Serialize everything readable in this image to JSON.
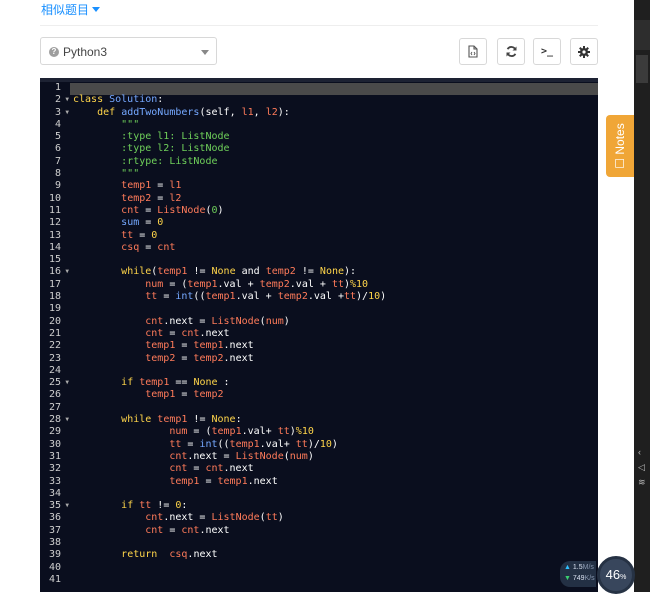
{
  "header": {
    "similar_label": "相似题目"
  },
  "toolbar": {
    "language": "Python3",
    "console_glyph": ">_"
  },
  "notes": {
    "label": "Notes"
  },
  "editor": {
    "line_numbers": [
      "1",
      "2",
      "3",
      "4",
      "5",
      "6",
      "7",
      "8",
      "9",
      "10",
      "11",
      "12",
      "13",
      "14",
      "15",
      "16",
      "17",
      "18",
      "19",
      "20",
      "21",
      "22",
      "23",
      "24",
      "25",
      "26",
      "27",
      "28",
      "29",
      "30",
      "31",
      "32",
      "33",
      "34",
      "35",
      "36",
      "37",
      "38",
      "39",
      "40",
      "41"
    ],
    "fold_lines": [
      2,
      3,
      16,
      25,
      28,
      35
    ],
    "lines": [
      [],
      [
        [
          "k",
          "class "
        ],
        [
          "f",
          "Solution"
        ],
        [
          "n",
          ":"
        ]
      ],
      [
        [
          "n",
          "    "
        ],
        [
          "k",
          "def "
        ],
        [
          "f",
          "addTwoNumbers"
        ],
        [
          "n",
          "(self, "
        ],
        [
          "p",
          "l1"
        ],
        [
          "n",
          ", "
        ],
        [
          "p",
          "l2"
        ],
        [
          "n",
          "):"
        ]
      ],
      [
        [
          "c",
          "        \"\"\""
        ]
      ],
      [
        [
          "c",
          "        :type l1: ListNode"
        ]
      ],
      [
        [
          "c",
          "        :type l2: ListNode"
        ]
      ],
      [
        [
          "c",
          "        :rtype: ListNode"
        ]
      ],
      [
        [
          "c",
          "        \"\"\""
        ]
      ],
      [
        [
          "n",
          "        "
        ],
        [
          "p",
          "temp1"
        ],
        [
          "n",
          " = "
        ],
        [
          "p",
          "l1"
        ]
      ],
      [
        [
          "n",
          "        "
        ],
        [
          "p",
          "temp2"
        ],
        [
          "n",
          " = "
        ],
        [
          "p",
          "l2"
        ]
      ],
      [
        [
          "n",
          "        "
        ],
        [
          "p",
          "cnt"
        ],
        [
          "n",
          " = "
        ],
        [
          "p",
          "ListNode"
        ],
        [
          "n",
          "("
        ],
        [
          "c",
          "0"
        ],
        [
          "n",
          ")"
        ]
      ],
      [
        [
          "n",
          "        "
        ],
        [
          "f",
          "sum"
        ],
        [
          "n",
          " = "
        ],
        [
          "k",
          "0"
        ]
      ],
      [
        [
          "n",
          "        "
        ],
        [
          "p",
          "tt"
        ],
        [
          "n",
          " = "
        ],
        [
          "k",
          "0"
        ]
      ],
      [
        [
          "n",
          "        "
        ],
        [
          "p",
          "csq"
        ],
        [
          "n",
          " = "
        ],
        [
          "p",
          "cnt"
        ]
      ],
      [],
      [
        [
          "n",
          "        "
        ],
        [
          "k",
          "while"
        ],
        [
          "n",
          "("
        ],
        [
          "p",
          "temp1"
        ],
        [
          "n",
          " != "
        ],
        [
          "k",
          "None"
        ],
        [
          "n",
          " and "
        ],
        [
          "p",
          "temp2"
        ],
        [
          "n",
          " != "
        ],
        [
          "k",
          "None"
        ],
        [
          "n",
          "):"
        ]
      ],
      [
        [
          "n",
          "            "
        ],
        [
          "p",
          "num"
        ],
        [
          "n",
          " = ("
        ],
        [
          "p",
          "temp1"
        ],
        [
          "n",
          ".val + "
        ],
        [
          "p",
          "temp2"
        ],
        [
          "n",
          ".val + "
        ],
        [
          "p",
          "tt"
        ],
        [
          "n",
          ")"
        ],
        [
          "k",
          "%10"
        ]
      ],
      [
        [
          "n",
          "            "
        ],
        [
          "p",
          "tt"
        ],
        [
          "n",
          " = "
        ],
        [
          "f",
          "int"
        ],
        [
          "n",
          "(("
        ],
        [
          "p",
          "temp1"
        ],
        [
          "n",
          ".val + "
        ],
        [
          "p",
          "temp2"
        ],
        [
          "n",
          ".val +"
        ],
        [
          "p",
          "tt"
        ],
        [
          "n",
          ")/"
        ],
        [
          "k",
          "10"
        ],
        [
          "n",
          ")"
        ]
      ],
      [],
      [
        [
          "n",
          "            "
        ],
        [
          "p",
          "cnt"
        ],
        [
          "n",
          ".next = "
        ],
        [
          "p",
          "ListNode"
        ],
        [
          "n",
          "("
        ],
        [
          "p",
          "num"
        ],
        [
          "n",
          ")"
        ]
      ],
      [
        [
          "n",
          "            "
        ],
        [
          "p",
          "cnt"
        ],
        [
          "n",
          " = "
        ],
        [
          "p",
          "cnt"
        ],
        [
          "n",
          ".next"
        ]
      ],
      [
        [
          "n",
          "            "
        ],
        [
          "p",
          "temp1"
        ],
        [
          "n",
          " = "
        ],
        [
          "p",
          "temp1"
        ],
        [
          "n",
          ".next"
        ]
      ],
      [
        [
          "n",
          "            "
        ],
        [
          "p",
          "temp2"
        ],
        [
          "n",
          " = "
        ],
        [
          "p",
          "temp2"
        ],
        [
          "n",
          ".next"
        ]
      ],
      [],
      [
        [
          "n",
          "        "
        ],
        [
          "k",
          "if "
        ],
        [
          "p",
          "temp1"
        ],
        [
          "n",
          " == "
        ],
        [
          "k",
          "None"
        ],
        [
          "n",
          " :"
        ]
      ],
      [
        [
          "n",
          "            "
        ],
        [
          "p",
          "temp1"
        ],
        [
          "n",
          " = "
        ],
        [
          "p",
          "temp2"
        ]
      ],
      [],
      [
        [
          "n",
          "        "
        ],
        [
          "k",
          "while "
        ],
        [
          "p",
          "temp1"
        ],
        [
          "n",
          " != "
        ],
        [
          "k",
          "None"
        ],
        [
          "n",
          ":"
        ]
      ],
      [
        [
          "n",
          "                "
        ],
        [
          "p",
          "num"
        ],
        [
          "n",
          " = ("
        ],
        [
          "p",
          "temp1"
        ],
        [
          "n",
          ".val+ "
        ],
        [
          "p",
          "tt"
        ],
        [
          "n",
          ")"
        ],
        [
          "k",
          "%10"
        ]
      ],
      [
        [
          "n",
          "                "
        ],
        [
          "p",
          "tt"
        ],
        [
          "n",
          " = "
        ],
        [
          "f",
          "int"
        ],
        [
          "n",
          "(("
        ],
        [
          "p",
          "temp1"
        ],
        [
          "n",
          ".val+ "
        ],
        [
          "p",
          "tt"
        ],
        [
          "n",
          ")/"
        ],
        [
          "k",
          "10"
        ],
        [
          "n",
          ")"
        ]
      ],
      [
        [
          "n",
          "                "
        ],
        [
          "p",
          "cnt"
        ],
        [
          "n",
          ".next = "
        ],
        [
          "p",
          "ListNode"
        ],
        [
          "n",
          "("
        ],
        [
          "p",
          "num"
        ],
        [
          "n",
          ")"
        ]
      ],
      [
        [
          "n",
          "                "
        ],
        [
          "p",
          "cnt"
        ],
        [
          "n",
          " = "
        ],
        [
          "p",
          "cnt"
        ],
        [
          "n",
          ".next"
        ]
      ],
      [
        [
          "n",
          "                "
        ],
        [
          "p",
          "temp1"
        ],
        [
          "n",
          " = "
        ],
        [
          "p",
          "temp1"
        ],
        [
          "n",
          ".next"
        ]
      ],
      [],
      [
        [
          "n",
          "        "
        ],
        [
          "k",
          "if "
        ],
        [
          "p",
          "tt"
        ],
        [
          "n",
          " != "
        ],
        [
          "k",
          "0"
        ],
        [
          "n",
          ":"
        ]
      ],
      [
        [
          "n",
          "            "
        ],
        [
          "p",
          "cnt"
        ],
        [
          "n",
          ".next = "
        ],
        [
          "p",
          "ListNode"
        ],
        [
          "n",
          "("
        ],
        [
          "p",
          "tt"
        ],
        [
          "n",
          ")"
        ]
      ],
      [
        [
          "n",
          "            "
        ],
        [
          "p",
          "cnt"
        ],
        [
          "n",
          " = "
        ],
        [
          "p",
          "cnt"
        ],
        [
          "n",
          ".next"
        ]
      ],
      [],
      [
        [
          "n",
          "        "
        ],
        [
          "k",
          "return "
        ],
        [
          "n",
          " "
        ],
        [
          "p",
          "csq"
        ],
        [
          "n",
          ".next"
        ]
      ],
      [],
      []
    ]
  },
  "net_monitor": {
    "upload": "1.5",
    "upload_unit": "M/s",
    "download": "749",
    "download_unit": "K/s",
    "value": "46",
    "unit": "%"
  },
  "colors": {
    "editor_bg": "#0a0e1e",
    "keyword": "#ffd54a",
    "function": "#75a8ff",
    "param": "#ff7b5a",
    "comment": "#6fd05a",
    "notes_tab": "#f0a637",
    "link": "#1a90ff"
  }
}
